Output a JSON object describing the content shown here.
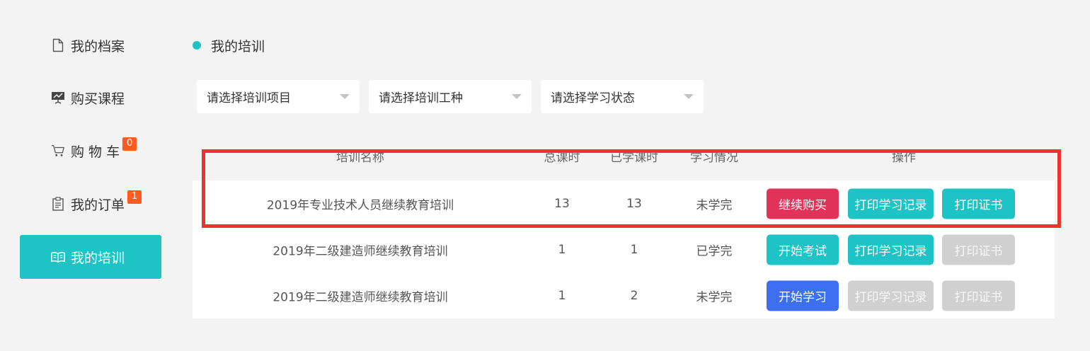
{
  "sidebar": {
    "items": [
      {
        "label": "我的档案",
        "icon": "document-icon"
      },
      {
        "label": "购买课程",
        "icon": "presentation-icon"
      },
      {
        "label": "购 物 车",
        "icon": "cart-icon",
        "badge": "0"
      },
      {
        "label": "我的订单",
        "icon": "clipboard-icon",
        "badge": "1"
      },
      {
        "label": "我的培训",
        "icon": "book-icon",
        "active": true
      }
    ]
  },
  "page": {
    "title": "我的培训"
  },
  "filters": {
    "project": "请选择培训项目",
    "job_type": "请选择培训工种",
    "status": "请选择学习状态"
  },
  "table": {
    "headers": [
      "培训名称",
      "总课时",
      "已学课时",
      "学习情况",
      "操作"
    ],
    "rows": [
      {
        "name": "2019年专业技术人员继续教育培训",
        "total": "13",
        "learned": "13",
        "status": "未学完",
        "actions": [
          {
            "label": "继续购买",
            "style": "red"
          },
          {
            "label": "打印学习记录",
            "style": "teal"
          },
          {
            "label": "打印证书",
            "style": "teal"
          }
        ]
      },
      {
        "name": "2019年二级建造师继续教育培训",
        "total": "1",
        "learned": "1",
        "status": "已学完",
        "actions": [
          {
            "label": "开始考试",
            "style": "teal"
          },
          {
            "label": "打印学习记录",
            "style": "teal"
          },
          {
            "label": "打印证书",
            "style": "gray"
          }
        ]
      },
      {
        "name": "2019年二级建造师继续教育培训",
        "total": "1",
        "learned": "2",
        "status": "未学完",
        "actions": [
          {
            "label": "开始学习",
            "style": "blue"
          },
          {
            "label": "打印学习记录",
            "style": "gray"
          },
          {
            "label": "打印证书",
            "style": "gray"
          }
        ]
      }
    ]
  },
  "colors": {
    "accent": "#1ec3c5",
    "danger": "#e1335a",
    "primary": "#3d6ff0",
    "disabled": "#d0d0d0",
    "badge": "#ff5a1f",
    "highlight_border": "#ee3131"
  }
}
